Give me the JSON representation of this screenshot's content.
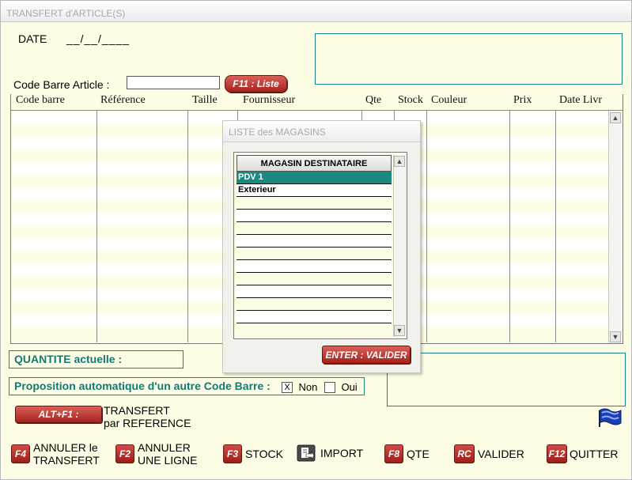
{
  "window": {
    "title": "TRANSFERT d'ARTICLE(S)"
  },
  "date": {
    "label": "DATE",
    "value": "__/__/____"
  },
  "barcode": {
    "label": "Code Barre Article :",
    "value": "",
    "list_button": "F11 : Liste"
  },
  "grid": {
    "columns": [
      "Code barre",
      "Référence",
      "Taille",
      "Fournisseur",
      "Qte",
      "Stock",
      "Couleur",
      "Prix",
      "Date Livr"
    ]
  },
  "quantity": {
    "label": "QUANTITE actuelle :"
  },
  "proposition": {
    "label": "Proposition automatique d'un autre Code Barre :",
    "non_label": "Non",
    "oui_label": "Oui",
    "selected": "Non",
    "check_mark": "X"
  },
  "altf1": {
    "key": "ALT+F1 :",
    "line1": "TRANSFERT",
    "line2": "par REFERENCE"
  },
  "popup": {
    "title": "LISTE des MAGASINS",
    "column": "MAGASIN DESTINATAIRE",
    "items": [
      "PDV 1",
      "Exterieur"
    ],
    "selected_index": 0,
    "validate_button": "ENTER : VALIDER"
  },
  "footer": {
    "annuler_transfert": {
      "key": "F4",
      "line1": "ANNULER le",
      "line2": "TRANSFERT"
    },
    "annuler_ligne": {
      "key": "F2",
      "line1": "ANNULER",
      "line2": "UNE LIGNE"
    },
    "stock": {
      "key": "F3",
      "label": "STOCK"
    },
    "import": {
      "icon": "import-icon",
      "label": "IMPORT"
    },
    "qte": {
      "key": "F8",
      "label": "QTE"
    },
    "valider": {
      "key": "RC",
      "label": "VALIDER"
    },
    "quitter": {
      "key": "F12",
      "label": "QUITTER"
    }
  },
  "colors": {
    "teal": "#137a72",
    "red_button": "#a6221c",
    "row_yellow": "#fdfde6",
    "selected_row": "#1a8a80"
  }
}
